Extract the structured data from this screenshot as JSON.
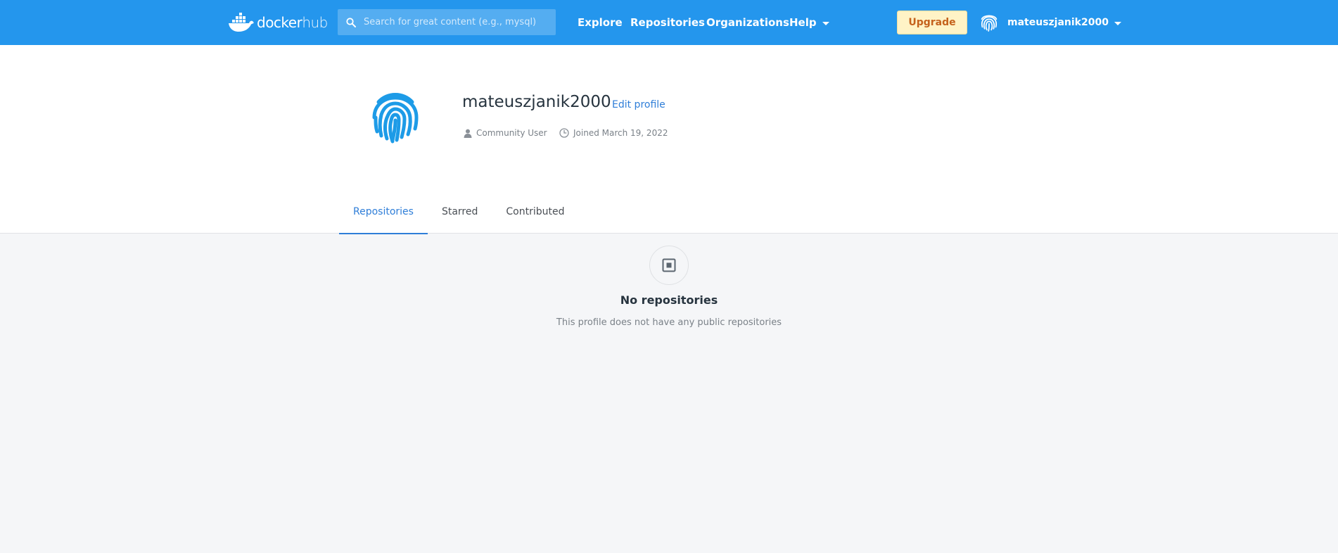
{
  "header": {
    "logo": {
      "word_docker": "docker",
      "word_hub": "hub"
    },
    "search": {
      "placeholder": "Search for great content (e.g., mysql)",
      "value": ""
    },
    "nav": {
      "explore": "Explore",
      "repositories": "Repositories",
      "organizations": "Organizations",
      "help": "Help"
    },
    "upgrade_label": "Upgrade",
    "user": {
      "name": "mateuszjanik2000"
    }
  },
  "profile": {
    "username": "mateuszjanik2000",
    "edit_label": "Edit profile",
    "role": "Community User",
    "joined": "Joined March 19, 2022"
  },
  "tabs": [
    {
      "label": "Repositories",
      "active": true
    },
    {
      "label": "Starred",
      "active": false
    },
    {
      "label": "Contributed",
      "active": false
    }
  ],
  "empty_state": {
    "title": "No repositories",
    "description": "This profile does not have any public repositories"
  },
  "colors": {
    "brand": "#2496ed",
    "link": "#2f7ed8",
    "upgrade_bg": "#fff3c6",
    "upgrade_text": "#c5621c",
    "page_bg": "#f5f6f8"
  },
  "icons": {
    "logo": "docker-whale-icon",
    "search": "search-icon",
    "avatar": "fingerprint-icon",
    "role": "user-icon",
    "joined": "clock-icon",
    "empty": "repository-box-icon"
  }
}
